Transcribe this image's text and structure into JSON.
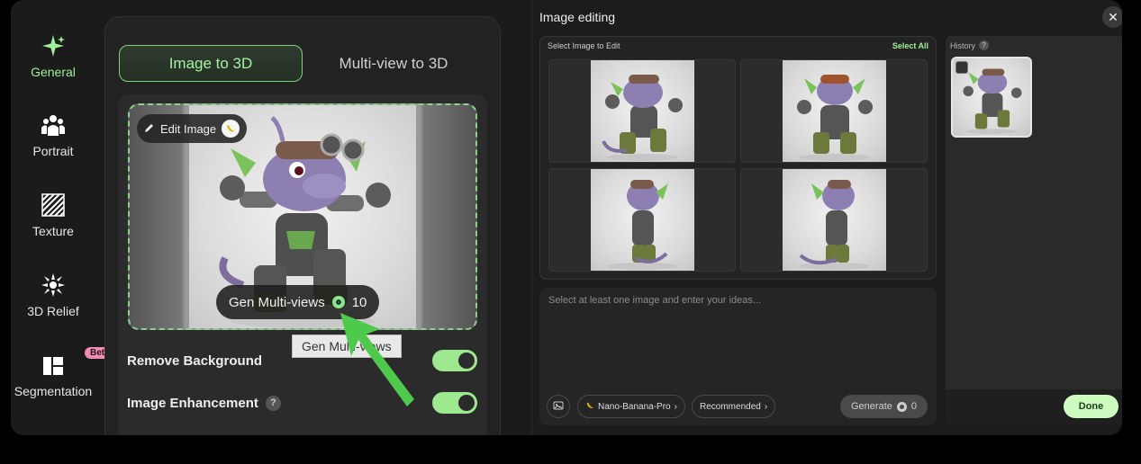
{
  "nav": {
    "items": [
      {
        "label": "General",
        "icon": "sparkle-icon",
        "active": true
      },
      {
        "label": "Portrait",
        "icon": "people-icon"
      },
      {
        "label": "Texture",
        "icon": "texture-icon"
      },
      {
        "label": "3D Relief",
        "icon": "relief-icon"
      },
      {
        "label": "Segmentation",
        "icon": "segmentation-icon",
        "badge": "Beta"
      }
    ]
  },
  "tabs": {
    "active": "Image to 3D",
    "inactive": "Multi-view to 3D"
  },
  "image_card": {
    "edit_label": "Edit Image",
    "gen_label": "Gen Multi-views",
    "gen_cost": "10",
    "tooltip": "Gen Multi-views"
  },
  "options": {
    "remove_bg": {
      "label": "Remove Background",
      "on": true
    },
    "enhance": {
      "label": "Image Enhancement",
      "help": "?",
      "on": true
    }
  },
  "modal": {
    "title": "Image editing",
    "close": "✕",
    "select_title": "Select Image to Edit",
    "select_all": "Select All",
    "prompt_placeholder": "Select at least one image and enter your ideas...",
    "model_label": "Nano-Banana-Pro",
    "model_chev": "›",
    "rec_label": "Recommended",
    "rec_chev": "›",
    "generate_label": "Generate",
    "generate_cost": "0",
    "history_title": "History",
    "history_help": "?",
    "done_label": "Done"
  },
  "colors": {
    "accent": "#9ff29a",
    "toggle_on": "#9ee98f",
    "arrow": "#4fc94b"
  }
}
